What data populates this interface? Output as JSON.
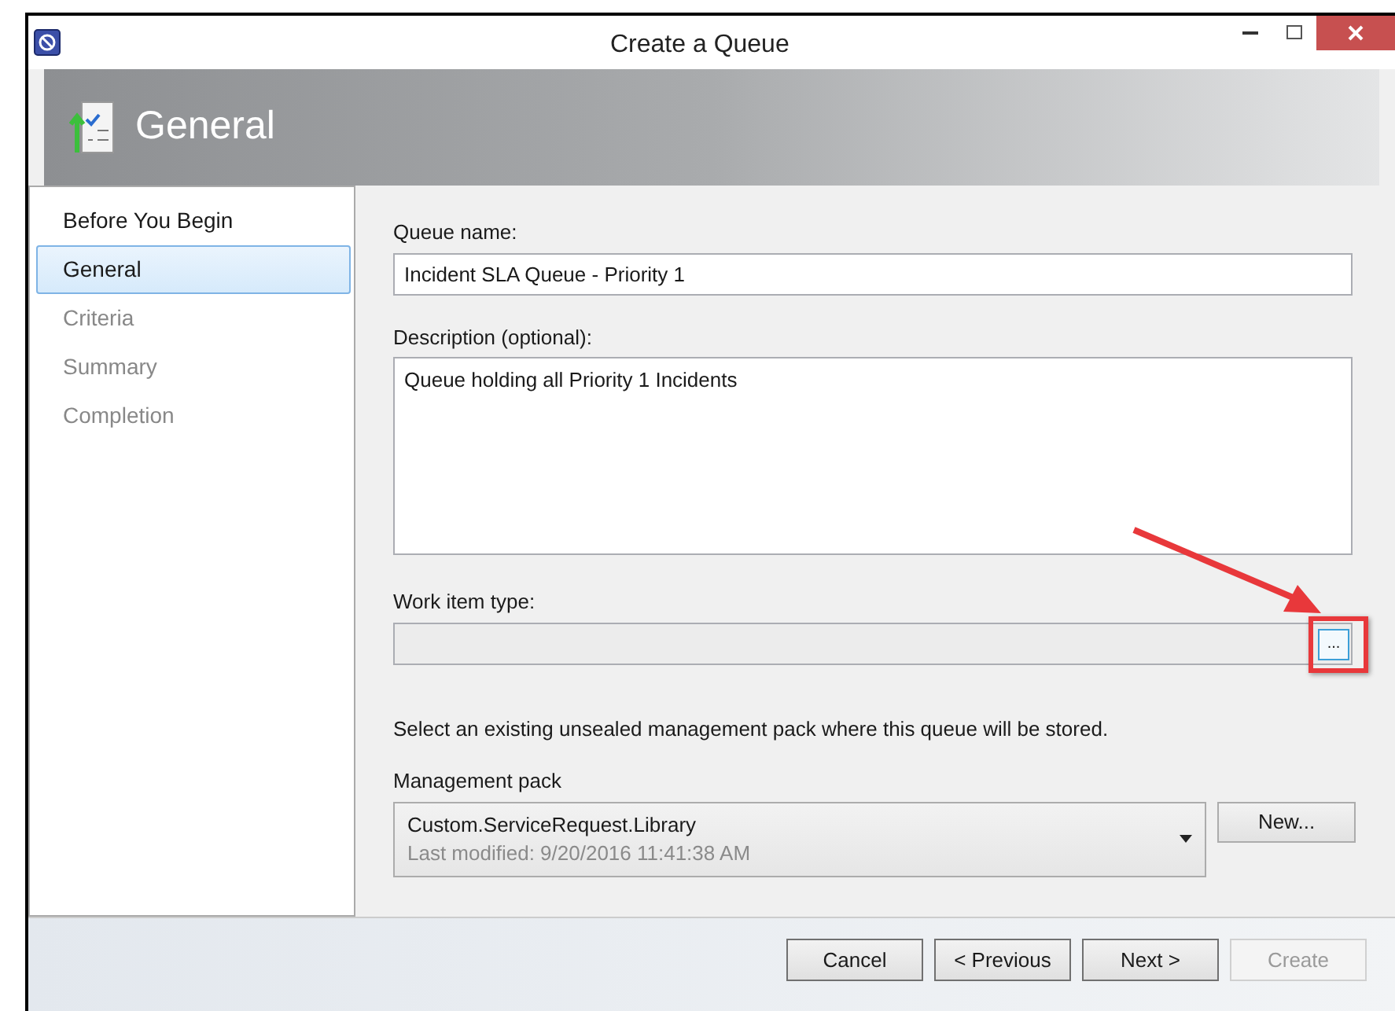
{
  "window": {
    "title": "Create a Queue"
  },
  "header": {
    "title": "General"
  },
  "steps": [
    {
      "label": "Before You Begin",
      "selected": false,
      "disabled": false
    },
    {
      "label": "General",
      "selected": true,
      "disabled": false
    },
    {
      "label": "Criteria",
      "selected": false,
      "disabled": true
    },
    {
      "label": "Summary",
      "selected": false,
      "disabled": true
    },
    {
      "label": "Completion",
      "selected": false,
      "disabled": true
    }
  ],
  "form": {
    "queue_name": {
      "label": "Queue name:",
      "value": "Incident SLA Queue - Priority 1"
    },
    "description": {
      "label": "Description (optional):",
      "value": "Queue holding all Priority 1 Incidents"
    },
    "work_item_type": {
      "label": "Work item type:",
      "browse_button": "...",
      "highlighted": true
    },
    "instruction": "Select an existing unsealed management pack where this queue will be stored.",
    "management_pack": {
      "label": "Management pack",
      "value": "Custom.ServiceRequest.Library",
      "detail": "Last modified:  9/20/2016 11:41:38 AM",
      "new_button": "New..."
    }
  },
  "buttons": [
    {
      "label": "Cancel",
      "disabled": false
    },
    {
      "label": "< Previous",
      "disabled": false
    },
    {
      "label": "Next >",
      "disabled": false
    },
    {
      "label": "Create",
      "disabled": true
    }
  ]
}
